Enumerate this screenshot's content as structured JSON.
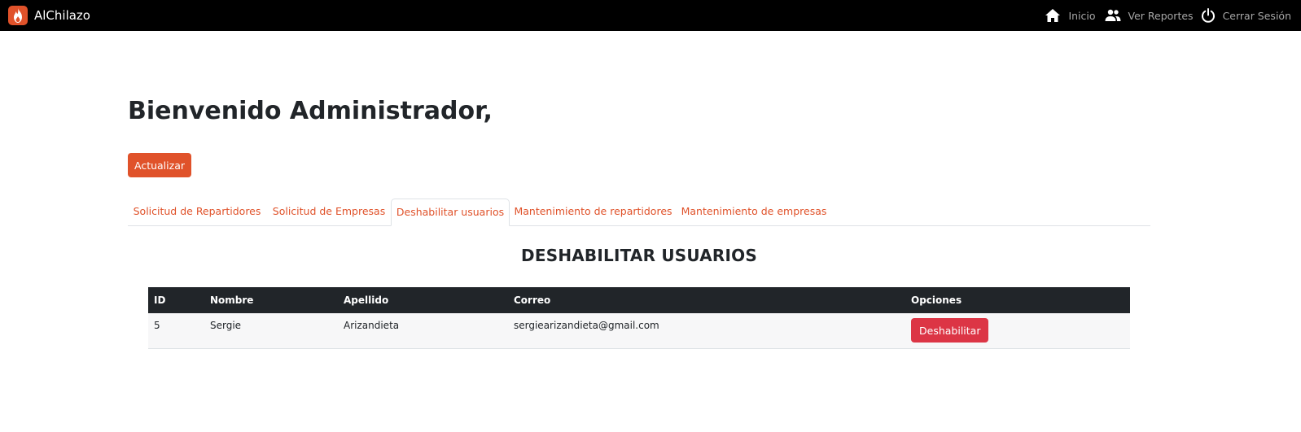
{
  "brand": {
    "name": "AlChilazo"
  },
  "colors": {
    "accent": "#e0522a",
    "danger": "#dc3545",
    "navbar": "#000000",
    "table_header": "#212529"
  },
  "nav": {
    "items": [
      {
        "icon": "home-icon",
        "label": "Inicio"
      },
      {
        "icon": "people-icon",
        "label": "Ver Reportes"
      },
      {
        "icon": "power-icon",
        "label": "Cerrar Sesión"
      }
    ]
  },
  "main": {
    "title": "Bienvenido Administrador,",
    "refresh_label": "Actualizar",
    "tabs": [
      {
        "label": "Solicitud de Repartidores",
        "active": false
      },
      {
        "label": "Solicitud de Empresas",
        "active": false
      },
      {
        "label": "Deshabilitar usuarios",
        "active": true
      },
      {
        "label": "Mantenimiento de repartidores",
        "active": false
      },
      {
        "label": "Mantenimiento de empresas",
        "active": false
      }
    ],
    "section_title": "DESHABILITAR USUARIOS"
  },
  "table": {
    "headers": [
      "ID",
      "Nombre",
      "Apellido",
      "Correo",
      "Opciones"
    ],
    "rows": [
      {
        "id": "5",
        "nombre": "Sergie",
        "apellido": "Arizandieta",
        "correo": "sergiearizandieta@gmail.com",
        "action": "Deshabilitar"
      }
    ]
  }
}
